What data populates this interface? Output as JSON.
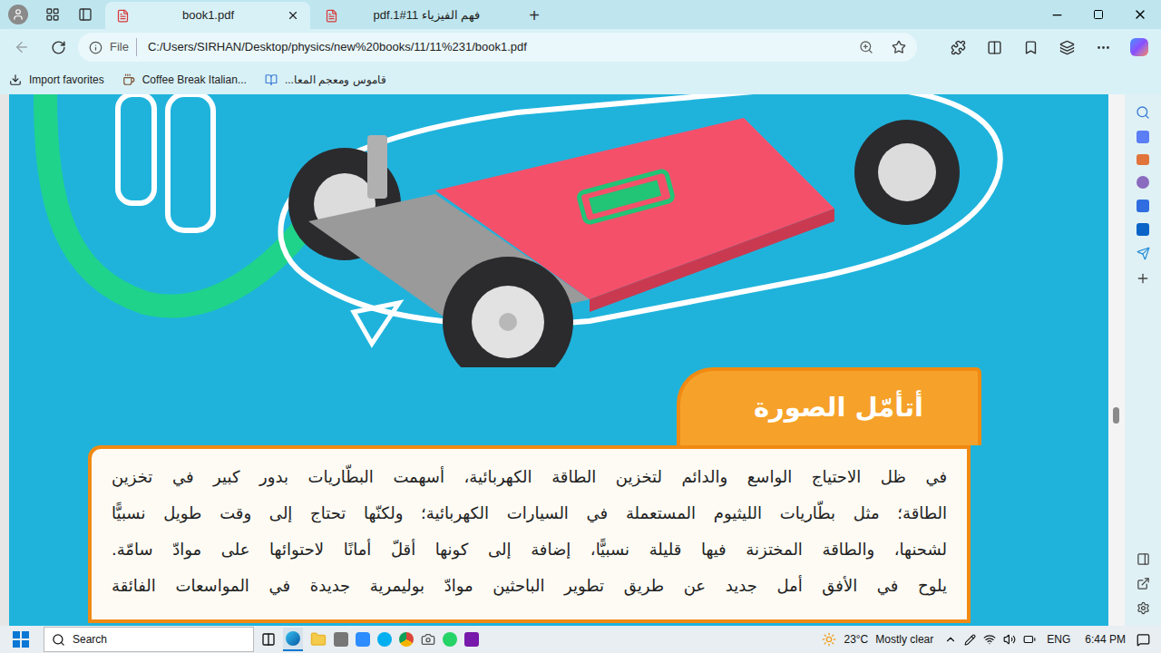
{
  "browser": {
    "tabs": [
      {
        "label": "book1.pdf",
        "selected": true
      },
      {
        "label": "فهم الفيزياء 11#1.pdf",
        "selected": false
      }
    ],
    "new_tab": "+",
    "address": {
      "scheme": "File",
      "url": "C:/Users/SIRHAN/Desktop/physics/new%20books/11/11%231/book1.pdf"
    },
    "favorites": [
      "Import favorites",
      "Coffee Break Italian...",
      "قاموس ومعجم المعا..."
    ]
  },
  "pdf": {
    "section_title": "أتأمّل الصورة",
    "lines": [
      "في ظل الاحتياج الواسع والدائم لتخزين الطاقة الكهربائية، أسهمت البطّاريات بدور كبير في تخزين",
      "الطاقة؛ مثل بطّاريات الليثيوم المستعملة في السيارات الكهربائية؛ ولكنّها تحتاج إلى وقت طويل نسبيًّا",
      "لشحنها، والطاقة المختزنة فيها قليلة نسبيًّا، إضافة إلى كونها أقلّ أمانًا لاحتوائها على موادّ سامّة.",
      "يلوح في الأفق أمل جديد عن طريق تطوير الباحثين موادّ بوليمرية جديدة في المواسعات الفائقة"
    ]
  },
  "scrollbar": {
    "level": 0.62
  },
  "taskbar": {
    "search_placeholder": "Search",
    "weather": {
      "temp": "23°C",
      "condition": "Mostly clear"
    },
    "language": "ENG",
    "time": "6:44 PM"
  }
}
